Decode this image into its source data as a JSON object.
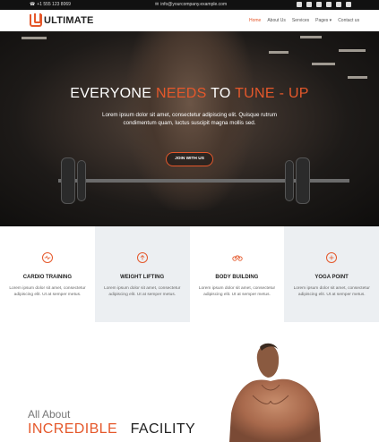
{
  "topbar": {
    "phone": "+1 555 123 8069",
    "email": "info@yourcompany.example.com",
    "social_icons": [
      "facebook-icon",
      "twitter-icon",
      "linkedin-icon",
      "youtube-icon",
      "email-icon",
      "github-icon"
    ]
  },
  "nav": {
    "logo_text": "ULTIMATE",
    "items": [
      {
        "label": "Home",
        "active": true
      },
      {
        "label": "About Us",
        "active": false
      },
      {
        "label": "Services",
        "active": false
      },
      {
        "label": "Pages ▾",
        "active": false
      },
      {
        "label": "Contact us",
        "active": false
      }
    ]
  },
  "hero": {
    "title_part1": "EVERYONE ",
    "title_accent1": "NEEDS",
    "title_part2": " TO ",
    "title_accent2": "TUNE - UP",
    "subtitle": "Lorem ipsum dolor sit amet, consectetur adipiscing elit. Quisque rutrum condimentum quam, luctus suscipit magna mollis sed.",
    "button_label": "JOIN WITH US"
  },
  "features": [
    {
      "title": "CARDIO TRAINING",
      "text": "Lorem ipsum dolor sit amet, consectetur adipiscing elit. Ut at semper metus.",
      "icon": "cardio-icon"
    },
    {
      "title": "WEIGHT LIFTING",
      "text": "Lorem ipsum dolor sit amet, consectetur adipiscing elit. Ut at semper metus.",
      "icon": "arrow-up-circle-icon"
    },
    {
      "title": "BODY BUILDING",
      "text": "Lorem ipsum dolor sit amet, consectetur adipiscing elit. Ut at semper metus.",
      "icon": "dumbbell-icon"
    },
    {
      "title": "YOGA POINT",
      "text": "Lorem ipsum dolor sit amet, consectetur adipiscing elit. Ut at semper metus.",
      "icon": "plus-circle-icon"
    }
  ],
  "about": {
    "small_heading": "All About",
    "accent_word": "INCREDIBLE",
    "plain_word": "FACILITY"
  },
  "colors": {
    "accent": "#e5582b",
    "topbar_bg": "#111111",
    "feature_alt_bg": "#eceff2"
  }
}
